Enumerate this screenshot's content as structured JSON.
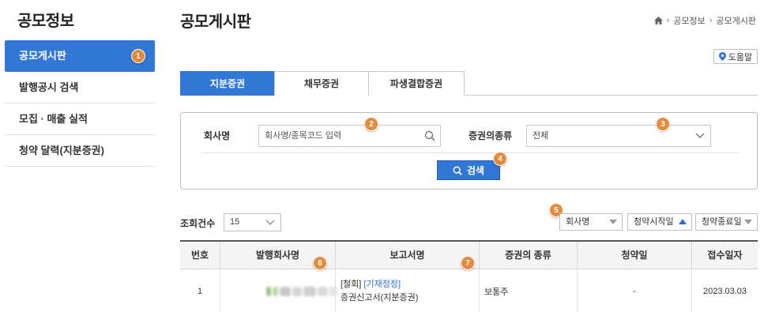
{
  "sidebar": {
    "title": "공모정보",
    "items": [
      {
        "label": "공모게시판",
        "active": true,
        "marker": "1"
      },
      {
        "label": "발행공시 검색"
      },
      {
        "label": "모집 · 매출 실적"
      },
      {
        "label": "청약 달력(지분증권)"
      }
    ]
  },
  "header": {
    "title": "공모게시판",
    "breadcrumb": [
      "공모정보",
      "공모게시판"
    ],
    "help_label": "도움말"
  },
  "tabs": [
    "지분증권",
    "채무증권",
    "파생결합증권"
  ],
  "search": {
    "company_label": "회사명",
    "company_placeholder": "회사명/종목코드 입력",
    "type_label": "증권의종류",
    "type_value": "전체",
    "button_label": "검색"
  },
  "toolbar": {
    "count_label": "조회건수",
    "count_value": "15",
    "sort_options": [
      "회사명",
      "청약시작일",
      "청약종료일"
    ]
  },
  "table": {
    "headers": [
      "번호",
      "발행회사명",
      "보고서명",
      "증권의 종류",
      "청약일",
      "접수일자"
    ],
    "rows": [
      {
        "no": "1",
        "report_prefix": "[철회]",
        "report_link": "[기재정정]",
        "report_name": "증권신고서(지분증권)",
        "security_type": "보통주",
        "subscription_date": "-",
        "received_date": "2023.03.03"
      }
    ]
  },
  "markers": [
    "1",
    "2",
    "3",
    "4",
    "5",
    "6",
    "7"
  ],
  "colors": {
    "accent": "#3178d6",
    "marker": "#e58a3c"
  }
}
